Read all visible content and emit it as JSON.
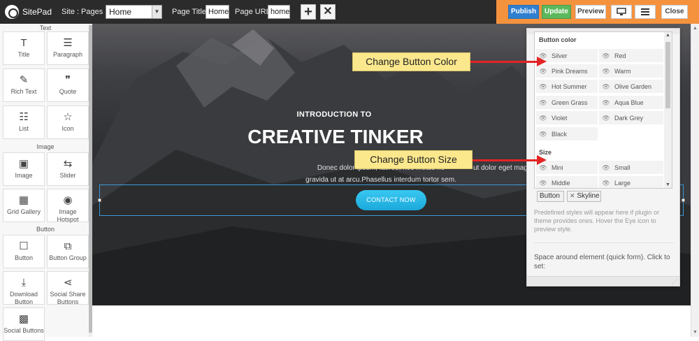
{
  "topbar": {
    "brand": "SitePad",
    "site_label": "Site :",
    "pages_label": "Pages :",
    "pages_value": "Home",
    "page_title_label": "Page Title:",
    "page_title_value": "Home",
    "page_url_label": "Page URL:",
    "page_url_value": "home",
    "add_icon": "plus-icon",
    "remove_icon": "close-icon",
    "publish": "Publish",
    "update": "Update",
    "preview": "Preview",
    "close": "Close",
    "colors": {
      "bar": "#2b2b2b",
      "orange": "#f5923e",
      "publish": "#2f7fd0",
      "update": "#5cb85c"
    }
  },
  "sidebar": {
    "sections": [
      {
        "label": "Text",
        "items": [
          {
            "label": "Title",
            "icon": "T"
          },
          {
            "label": "Paragraph",
            "icon": "☰"
          },
          {
            "label": "Rich Text",
            "icon": "✎"
          },
          {
            "label": "Quote",
            "icon": "❞"
          },
          {
            "label": "List",
            "icon": "☷"
          },
          {
            "label": "Icon",
            "icon": "☆"
          }
        ]
      },
      {
        "label": "Image",
        "items": [
          {
            "label": "Image",
            "icon": "▣"
          },
          {
            "label": "Slider",
            "icon": "⇆"
          },
          {
            "label": "Grid Gallery",
            "icon": "▦"
          },
          {
            "label": "Image Hotspot",
            "icon": "◉"
          }
        ]
      },
      {
        "label": "Button",
        "items": [
          {
            "label": "Button",
            "icon": "☐"
          },
          {
            "label": "Button Group",
            "icon": "⧉"
          },
          {
            "label": "Download Button",
            "icon": "⤓"
          },
          {
            "label": "Social Share Buttons",
            "icon": "⋖"
          },
          {
            "label": "Social Buttons",
            "icon": "▩"
          }
        ]
      }
    ]
  },
  "hero": {
    "kicker": "INTRODUCTION TO",
    "title": "CREATIVE TINKER",
    "body_line1": "Donec dolor ipsum, laoreet nec metus no",
    "body_line1_tail": "ut dolor eget mag",
    "body_line2": "gravida ut at arcu.Phasellus interdum tortor sem.",
    "cta": "CONTACT NOW",
    "cta_color": "#1ca9db"
  },
  "panel": {
    "button_color_heading": "Button color",
    "colors": [
      "Silver",
      "Red",
      "Pink Dreams",
      "Warm",
      "Hot Summer",
      "Olive Garden",
      "Green Grass",
      "Aqua Blue",
      "Violet",
      "Dark Grey",
      "Black"
    ],
    "size_heading": "Size",
    "sizes": [
      "Mini",
      "Small",
      "Middle",
      "Large"
    ],
    "tags": [
      "Button",
      "Skyline"
    ],
    "help_text": "Predefined styles will appear here if plugin or theme provides ones. Hover the Eye icon to preview style.",
    "spacing_text": "Space around element (quick form). Click to set:"
  },
  "callouts": {
    "color": "Change Button Color",
    "size": "Change Button Size",
    "arrow_color": "#e32424"
  }
}
